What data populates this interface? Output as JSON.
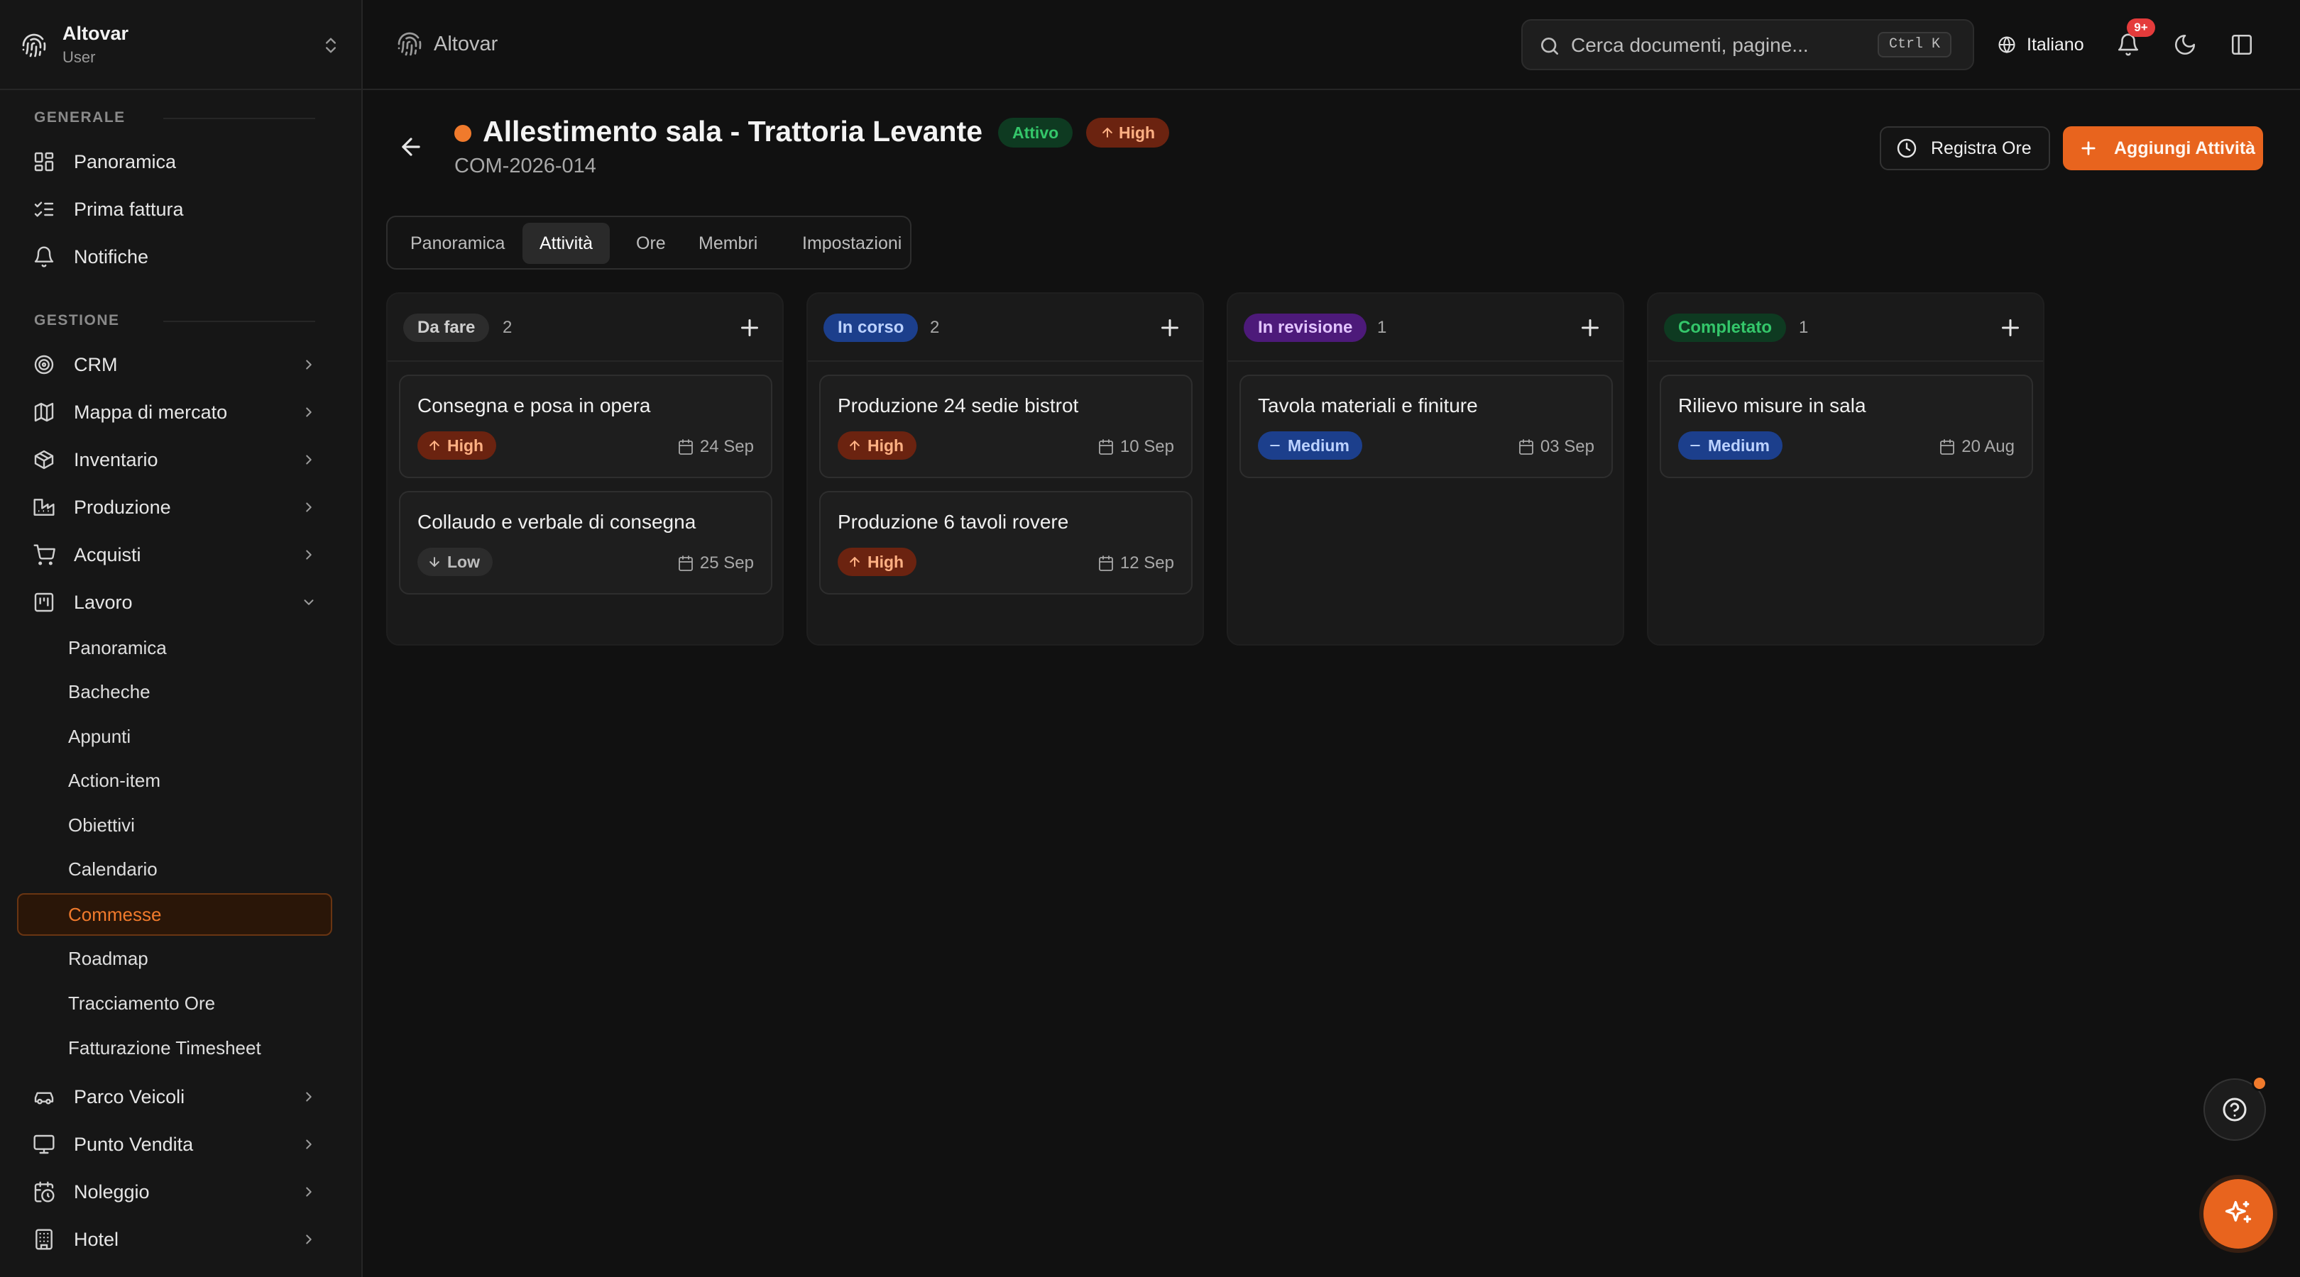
{
  "app": {
    "name": "Altovar",
    "role": "User"
  },
  "sidebar": {
    "sections": [
      {
        "title": "GENERALE",
        "items": [
          {
            "label": "Panoramica",
            "icon": "layout-dashboard-icon"
          },
          {
            "label": "Prima fattura",
            "icon": "list-checks-icon"
          },
          {
            "label": "Notifiche",
            "icon": "bell-icon"
          }
        ]
      },
      {
        "title": "GESTIONE",
        "items": [
          {
            "label": "CRM",
            "icon": "target-icon"
          },
          {
            "label": "Mappa di mercato",
            "icon": "map-icon"
          },
          {
            "label": "Inventario",
            "icon": "package-icon"
          },
          {
            "label": "Produzione",
            "icon": "factory-icon"
          },
          {
            "label": "Acquisti",
            "icon": "cart-icon"
          },
          {
            "label": "Lavoro",
            "icon": "kanban-icon",
            "expanded": true
          }
        ]
      }
    ],
    "lavoro_children": [
      {
        "label": "Panoramica"
      },
      {
        "label": "Bacheche"
      },
      {
        "label": "Appunti"
      },
      {
        "label": "Action-item"
      },
      {
        "label": "Obiettivi"
      },
      {
        "label": "Calendario"
      },
      {
        "label": "Commesse",
        "active": true
      },
      {
        "label": "Roadmap"
      },
      {
        "label": "Tracciamento Ore"
      },
      {
        "label": "Fatturazione Timesheet"
      }
    ],
    "more_items": [
      {
        "label": "Parco Veicoli",
        "icon": "car-icon"
      },
      {
        "label": "Punto Vendita",
        "icon": "monitor-icon"
      },
      {
        "label": "Noleggio",
        "icon": "calendar-clock-icon"
      },
      {
        "label": "Hotel",
        "icon": "building-icon"
      }
    ]
  },
  "topbar": {
    "title": "Altovar",
    "search_placeholder": "Cerca documenti, pagine...",
    "search_shortcut": "Ctrl K",
    "language": "Italiano",
    "notifications_badge": "9+"
  },
  "project": {
    "title": "Allestimento sala - Trattoria Levante",
    "status": "Attivo",
    "priority": "High",
    "code": "COM-2026-014",
    "actions": {
      "log_hours": "Registra Ore",
      "add_activity": "Aggiungi Attività"
    },
    "tabs": [
      "Panoramica",
      "Attività",
      "Ore",
      "Membri",
      "Impostazioni"
    ],
    "active_tab": "Attività"
  },
  "board": {
    "columns": [
      {
        "label": "Da fare",
        "count": "2",
        "cards": [
          {
            "title": "Consegna e posa in opera",
            "priority": "High",
            "due": "24 Sep"
          },
          {
            "title": "Collaudo e verbale di consegna",
            "priority": "Low",
            "due": "25 Sep"
          }
        ]
      },
      {
        "label": "In corso",
        "count": "2",
        "cards": [
          {
            "title": "Produzione 24 sedie bistrot",
            "priority": "High",
            "due": "10 Sep"
          },
          {
            "title": "Produzione 6 tavoli rovere",
            "priority": "High",
            "due": "12 Sep"
          }
        ]
      },
      {
        "label": "In revisione",
        "count": "1",
        "cards": [
          {
            "title": "Tavola materiali e finiture",
            "priority": "Medium",
            "due": "03 Sep"
          }
        ]
      },
      {
        "label": "Completato",
        "count": "1",
        "cards": [
          {
            "title": "Rilievo misure in sala",
            "priority": "Medium",
            "due": "20 Aug"
          }
        ]
      }
    ]
  },
  "colors": {
    "accent": "#e8641e",
    "status_green": "#34c66a",
    "high": "#ffb083",
    "medium": "#bcd2ff",
    "purple": "#e2c4ff"
  }
}
